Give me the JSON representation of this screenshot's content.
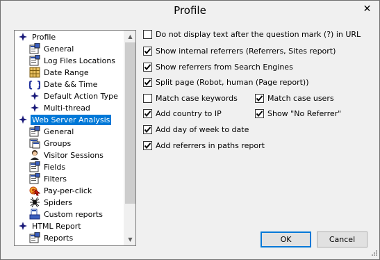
{
  "window": {
    "title": "Profile",
    "close_glyph": "✕"
  },
  "tree": {
    "items": [
      {
        "label": "Profile",
        "icon": "diamond-icon",
        "level": 0,
        "selected": false
      },
      {
        "label": "General",
        "icon": "general-settings-icon",
        "level": 1,
        "selected": false
      },
      {
        "label": "Log Files Locations",
        "icon": "log-files-icon",
        "level": 1,
        "selected": false
      },
      {
        "label": "Date Range",
        "icon": "calendar-grid-icon",
        "level": 1,
        "selected": false
      },
      {
        "label": "Date && Time",
        "icon": "braces-icon",
        "level": 1,
        "selected": false
      },
      {
        "label": "Default Action Type",
        "icon": "diamond-icon",
        "level": 1,
        "selected": false
      },
      {
        "label": "Multi-thread",
        "icon": "diamond-icon",
        "level": 1,
        "selected": false
      },
      {
        "label": "Web Server Analysis",
        "icon": "diamond-icon",
        "level": 0,
        "selected": true
      },
      {
        "label": "General",
        "icon": "general-settings-icon",
        "level": 1,
        "selected": false
      },
      {
        "label": "Groups",
        "icon": "groups-icon",
        "level": 1,
        "selected": false
      },
      {
        "label": "Visitor Sessions",
        "icon": "visitor-icon",
        "level": 1,
        "selected": false
      },
      {
        "label": "Fields",
        "icon": "fields-icon",
        "level": 1,
        "selected": false
      },
      {
        "label": "Filters",
        "icon": "filters-icon",
        "level": 1,
        "selected": false
      },
      {
        "label": "Pay-per-click",
        "icon": "pay-per-click-icon",
        "level": 1,
        "selected": false
      },
      {
        "label": "Spiders",
        "icon": "spider-icon",
        "level": 1,
        "selected": false
      },
      {
        "label": "Custom reports",
        "icon": "custom-reports-icon",
        "level": 1,
        "selected": false
      },
      {
        "label": "HTML Report",
        "icon": "diamond-icon",
        "level": 0,
        "selected": false
      },
      {
        "label": "Reports",
        "icon": "general-settings-icon",
        "level": 1,
        "selected": false
      }
    ]
  },
  "options": [
    {
      "label": "Do not display text after the question mark (?) in URL",
      "checked": false
    },
    {
      "label": "Show internal referrers (Referrers, Sites report)",
      "checked": true
    },
    {
      "label": "Show referrers from Search Engines",
      "checked": true
    },
    {
      "label": "Split page (Robot, human (Page report))",
      "checked": true
    },
    {
      "label": "Match case keywords",
      "checked": false
    },
    {
      "label": "Match case users",
      "checked": true
    },
    {
      "label": "Add country to IP",
      "checked": true
    },
    {
      "label": "Show \"No Referrer\"",
      "checked": true
    },
    {
      "label": "Add day of week to date",
      "checked": true
    },
    {
      "label": "Add referrers in paths report",
      "checked": true
    }
  ],
  "buttons": {
    "ok": "OK",
    "cancel": "Cancel"
  },
  "colors": {
    "selection": "#0078d7",
    "diamond": "#1a1a7a"
  }
}
